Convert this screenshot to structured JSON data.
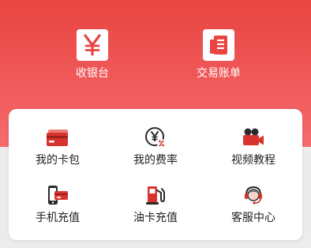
{
  "colors": {
    "header_red": "#e84540",
    "icon_red": "#d9332e",
    "icon_dark": "#2a2a2a"
  },
  "top_actions": [
    {
      "label": "收银台",
      "icon": "yen-icon"
    },
    {
      "label": "交易账单",
      "icon": "bill-icon"
    }
  ],
  "services": [
    {
      "label": "我的卡包",
      "icon": "card-wallet-icon"
    },
    {
      "label": "我的费率",
      "icon": "fee-rate-icon"
    },
    {
      "label": "视频教程",
      "icon": "video-icon"
    },
    {
      "label": "手机充值",
      "icon": "phone-recharge-icon"
    },
    {
      "label": "油卡充值",
      "icon": "fuel-pump-icon"
    },
    {
      "label": "客服中心",
      "icon": "customer-service-icon"
    }
  ]
}
